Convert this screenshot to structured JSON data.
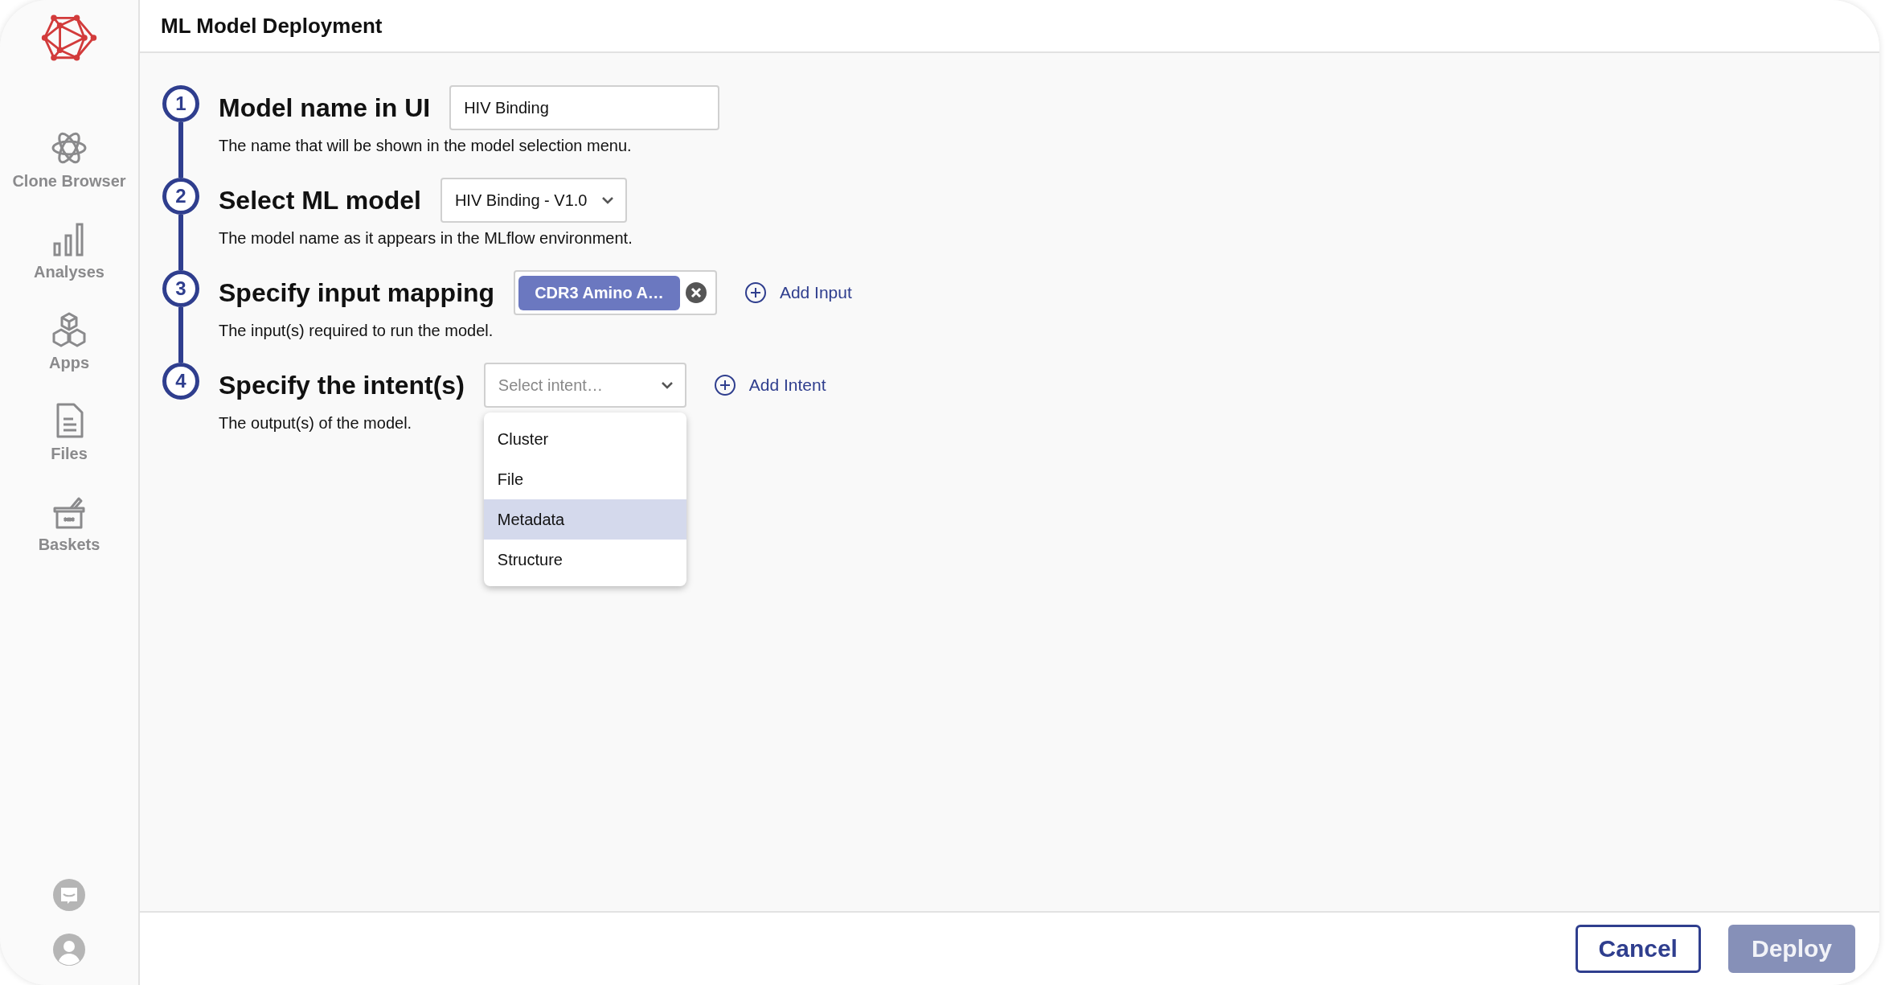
{
  "sidebar": {
    "items": [
      {
        "label": "Clone Browser",
        "kind": "atom"
      },
      {
        "label": "Analyses",
        "kind": "bars"
      },
      {
        "label": "Apps",
        "kind": "cubes"
      },
      {
        "label": "Files",
        "kind": "file"
      },
      {
        "label": "Baskets",
        "kind": "basket"
      }
    ],
    "bottom": [
      {
        "kind": "chat"
      },
      {
        "kind": "user"
      }
    ]
  },
  "header": {
    "title": "ML Model Deployment"
  },
  "steps": [
    {
      "number": "1",
      "title": "Model name in UI",
      "description": "The name that will be shown in the model selection menu.",
      "kind": "text",
      "value": "HIV Binding"
    },
    {
      "number": "2",
      "title": "Select ML model",
      "description": "The model name as it appears in the MLflow environment.",
      "kind": "select",
      "value": "HIV Binding - V1.0"
    },
    {
      "number": "3",
      "title": "Specify input mapping",
      "description": "The input(s) required to run the model.",
      "kind": "chips",
      "chips": [
        "CDR3 Amino A…"
      ],
      "add_label": "Add Input"
    },
    {
      "number": "4",
      "title": "Specify the intent(s)",
      "description": "The output(s) of the model.",
      "kind": "select",
      "placeholder": "Select intent…",
      "add_label": "Add Intent",
      "expanded": true,
      "options": [
        {
          "label": "Cluster",
          "selected": false
        },
        {
          "label": "File",
          "selected": false
        },
        {
          "label": "Metadata",
          "selected": true
        },
        {
          "label": "Structure",
          "selected": false
        }
      ]
    }
  ],
  "footer": {
    "buttons": [
      {
        "label": "Cancel",
        "kind": "secondary",
        "disabled": false
      },
      {
        "label": "Deploy",
        "kind": "primary",
        "disabled": true
      }
    ]
  }
}
